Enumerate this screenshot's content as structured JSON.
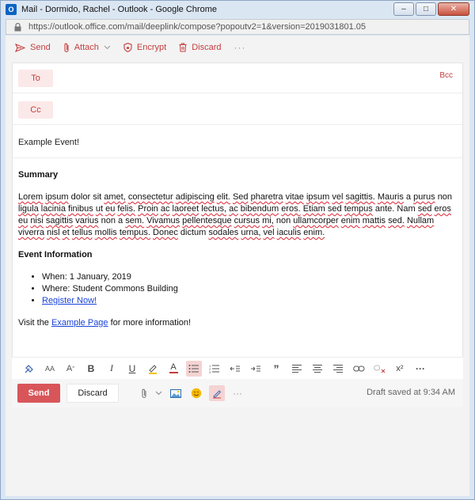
{
  "window": {
    "title": "Mail - Dormido, Rachel - Outlook - Google Chrome",
    "app_icon": "outlook-icon",
    "url": "https://outlook.office.com/mail/deeplink/compose?popoutv2=1&version=2019031801.05"
  },
  "toolbar": {
    "send_label": "Send",
    "attach_label": "Attach",
    "encrypt_label": "Encrypt",
    "discard_label": "Discard",
    "more_label": "···"
  },
  "recipients": {
    "to_label": "To",
    "cc_label": "Cc",
    "bcc_label": "Bcc"
  },
  "subject": "Example Event!",
  "body": {
    "summary_heading": "Summary",
    "lorem": "Lorem ipsum dolor sit amet, consectetur adipiscing elit. Sed pharetra vitae ipsum vel sagittis. Mauris a purus non ligula lacinia finibus ut eu felis. Proin ac laoreet lectus, ac bibendum eros. Etiam sed tempus ante. Nam sed eros eu nisi sagittis varius non a sem. Vivamus pellentesque cursus mi, non ullamcorper enim mattis sed. Nullam viverra nisl et tellus mollis tempus. Donec dictum sodales urna, vel iaculis enim.",
    "event_heading": "Event Information",
    "when": "When: 1 January, 2019",
    "where": "Where: Student Commons Building",
    "register": "Register Now!",
    "visit_prefix": "Visit the ",
    "visit_link": "Example Page",
    "visit_suffix": " for more information!"
  },
  "format_toolbar": {
    "font_size_glyph": "AA",
    "grow_font_glyph": "A",
    "bold": "B",
    "italic": "I",
    "underline": "U",
    "font_color": "A",
    "quote": "”",
    "superscript": "x²",
    "more": "···"
  },
  "sendbar": {
    "send_label": "Send",
    "discard_label": "Discard",
    "more_label": "···",
    "draft_status": "Draft saved at 9:34 AM"
  },
  "colors": {
    "accent": "#c43d3d",
    "send_button": "#d8565a",
    "pill_bg": "#fbe9e9",
    "link": "#1a44d8"
  }
}
